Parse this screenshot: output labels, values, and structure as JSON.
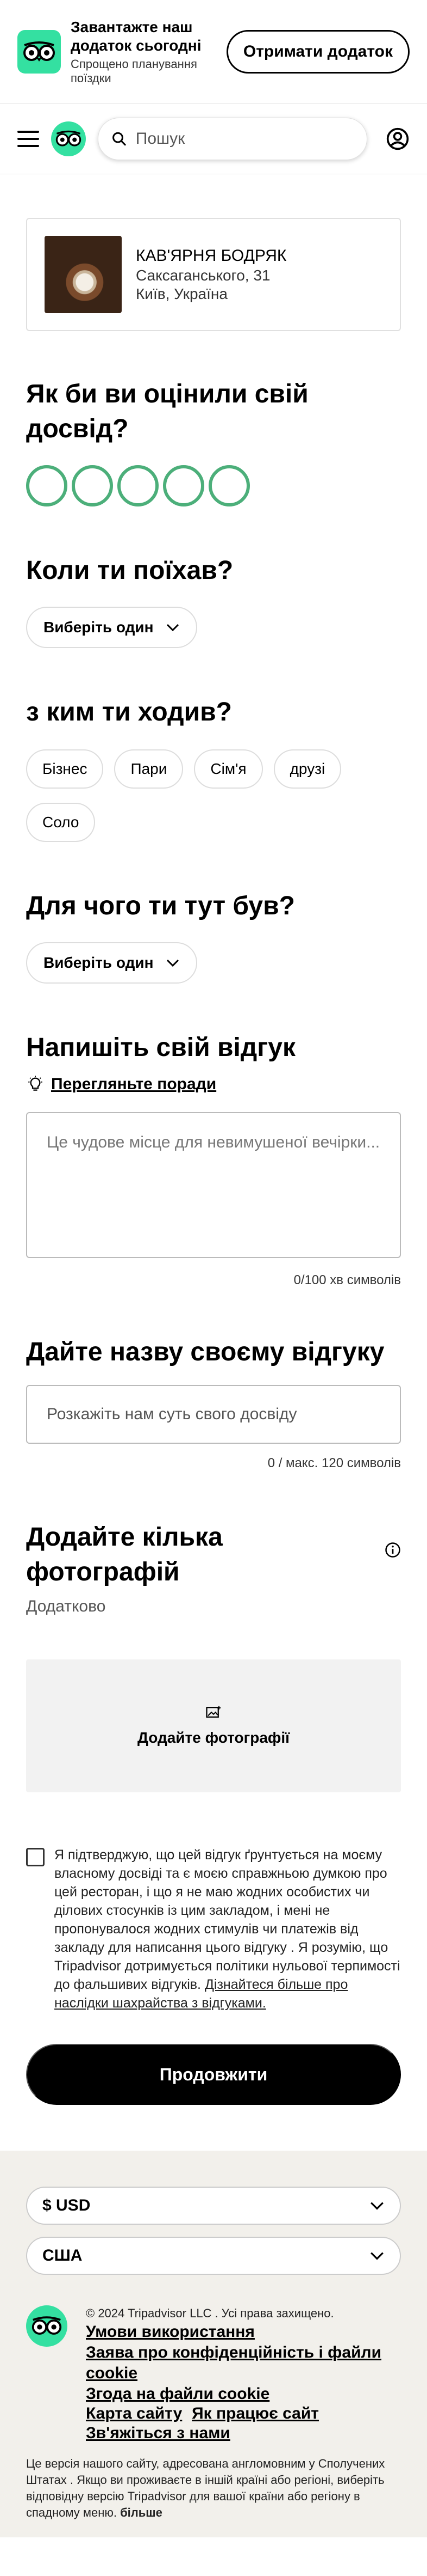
{
  "app_banner": {
    "title": "Завантажте наш додаток сьогодні",
    "subtitle": "Спрощено планування поїздки",
    "cta": "Отримати додаток",
    "logo_icon": "owl-logo-icon"
  },
  "header": {
    "search_placeholder": "Пошук",
    "menu_icon": "hamburger-menu-icon",
    "user_icon": "user-profile-icon"
  },
  "restaurant": {
    "name": "КАВ'ЯРНЯ БОДРЯК",
    "street": "Саксаганського, 31",
    "city": "Київ, Україна"
  },
  "rating": {
    "question": "Як би ви оцінили свій досвід?",
    "bubbles": 5,
    "accent_color": "#4caf7a"
  },
  "when": {
    "question": "Коли ти поїхав?",
    "select_label": "Виберіть один"
  },
  "who": {
    "question": "з ким ти ходив?",
    "options": [
      "Бізнес",
      "Пари",
      "Сім'я",
      "друзі",
      "Соло"
    ]
  },
  "purpose": {
    "question": "Для чого ти тут був?",
    "select_label": "Виберіть один"
  },
  "review": {
    "heading": "Напишіть свій відгук",
    "tips_link": "Перегляньте поради",
    "placeholder": "Це чудове місце для невимушеної вечірки...",
    "counter": "0/100 хв символів"
  },
  "review_title": {
    "heading": "Дайте назву своєму відгуку",
    "placeholder": "Розкажіть нам суть свого досвіду",
    "counter": "0 / макс. 120 символів"
  },
  "photos": {
    "heading": "Додайте кілька фотографій",
    "optional": "Додатково",
    "add_label": "Додайте фотографії"
  },
  "consent": {
    "text": "Я підтверджую, що цей відгук ґрунтується на моєму власному досвіді та є моєю справжньою думкою про цей ресторан, і що я не маю жодних особистих чи ділових стосунків із цим закладом, і мені не пропонувалося жодних стимулів чи платежів від закладу для написання цього відгуку . Я розумію, що Tripadvisor дотримується політики нульової терпимості до фальшивих відгуків. ",
    "link": "Дізнайтеся більше про наслідки шахрайства з відгуками."
  },
  "continue_label": "Продовжити",
  "footer": {
    "currency": "$ USD",
    "country": "США",
    "copyright": "© 2024 Tripadvisor LLC . Усі права захищено.",
    "links": [
      "Умови використання",
      "Заява про конфіденційність і файли cookie",
      "Згода на файли cookie"
    ],
    "link_sitemap": "Карта сайту",
    "link_how": "Як працює сайт",
    "link_contact": "Зв'яжіться з нами",
    "disclaimer": "Це версія нашого сайту, адресована англомовним у Сполучених Штатах . Якщо ви проживаєте в іншій країні або регіоні, виберіть відповідну версію Tripadvisor для вашої країни або регіону в спадному меню. ",
    "more": "більше"
  }
}
